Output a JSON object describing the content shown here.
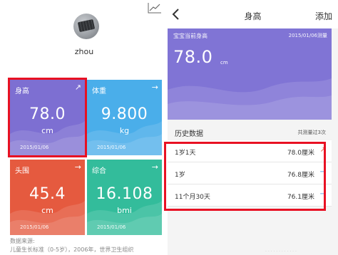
{
  "left_screen": {
    "user": {
      "name": "zhou"
    },
    "tiles": [
      {
        "label": "身高",
        "value": "78.0",
        "unit": "cm",
        "date": "2015/01/06",
        "color": "#7d6fd2",
        "trend": "up"
      },
      {
        "label": "体重",
        "value": "9.800",
        "unit": "kg",
        "date": "2015/01/06",
        "color": "#4aaeea",
        "trend": "flat"
      },
      {
        "label": "头围",
        "value": "45.4",
        "unit": "cm",
        "date": "2015/01/06",
        "color": "#e55a3f",
        "trend": "flat"
      },
      {
        "label": "综合",
        "value": "16.108",
        "unit": "bmi",
        "date": "2015/01/06",
        "color": "#33bc9b",
        "trend": "flat"
      }
    ],
    "source": {
      "label": "数据来源:",
      "text": "儿童生长标准（0-5岁），2006年，世界卫生组织"
    }
  },
  "right_screen": {
    "nav": {
      "title": "身高",
      "add_label": "添加"
    },
    "header": {
      "label": "宝宝当前身高",
      "date": "2015/01/06测量",
      "value": "78.0",
      "unit": "cm",
      "color": "#8074d5"
    },
    "history": {
      "title": "历史数据",
      "count": "共测量过3次",
      "rows": [
        {
          "age": "1岁1天",
          "value": "78.0厘米",
          "trend": "up"
        },
        {
          "age": "1岁",
          "value": "76.8厘米",
          "trend": "flat"
        },
        {
          "age": "11个月30天",
          "value": "76.1厘米",
          "trend": "flat"
        }
      ]
    }
  },
  "colors": {
    "highlight": "#e81123",
    "trend_up": "#e8513a",
    "trend_flat": "#3a90e0"
  }
}
